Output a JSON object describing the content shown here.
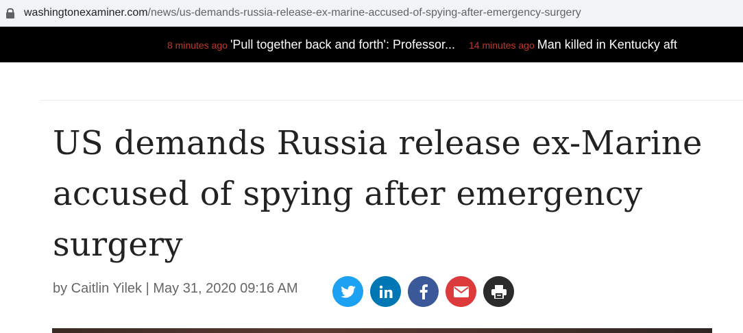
{
  "browser": {
    "url_domain": "washingtonexaminer.com",
    "url_path": "/news/us-demands-russia-release-ex-marine-accused-of-spying-after-emergency-surgery",
    "lock_icon": "lock-icon"
  },
  "ticker": {
    "items": [
      {
        "time": "8 minutes ago",
        "headline": "'Pull together back and forth': Professor..."
      },
      {
        "time": "14 minutes ago",
        "headline": "Man killed in Kentucky aft"
      }
    ]
  },
  "article": {
    "title": "US demands Russia release ex-Marine accused of spying after emergency surgery",
    "byline": "by Caitlin Yilek | May 31, 2020 09:16 AM"
  },
  "share": [
    {
      "name": "twitter",
      "icon": "twitter-icon",
      "color": "#1da1f2"
    },
    {
      "name": "linkedin",
      "icon": "linkedin-icon",
      "color": "#0077b5"
    },
    {
      "name": "facebook",
      "icon": "facebook-icon",
      "color": "#3b5998"
    },
    {
      "name": "email",
      "icon": "email-icon",
      "color": "#dd3b3b"
    },
    {
      "name": "print",
      "icon": "print-icon",
      "color": "#2b2b2b"
    }
  ]
}
